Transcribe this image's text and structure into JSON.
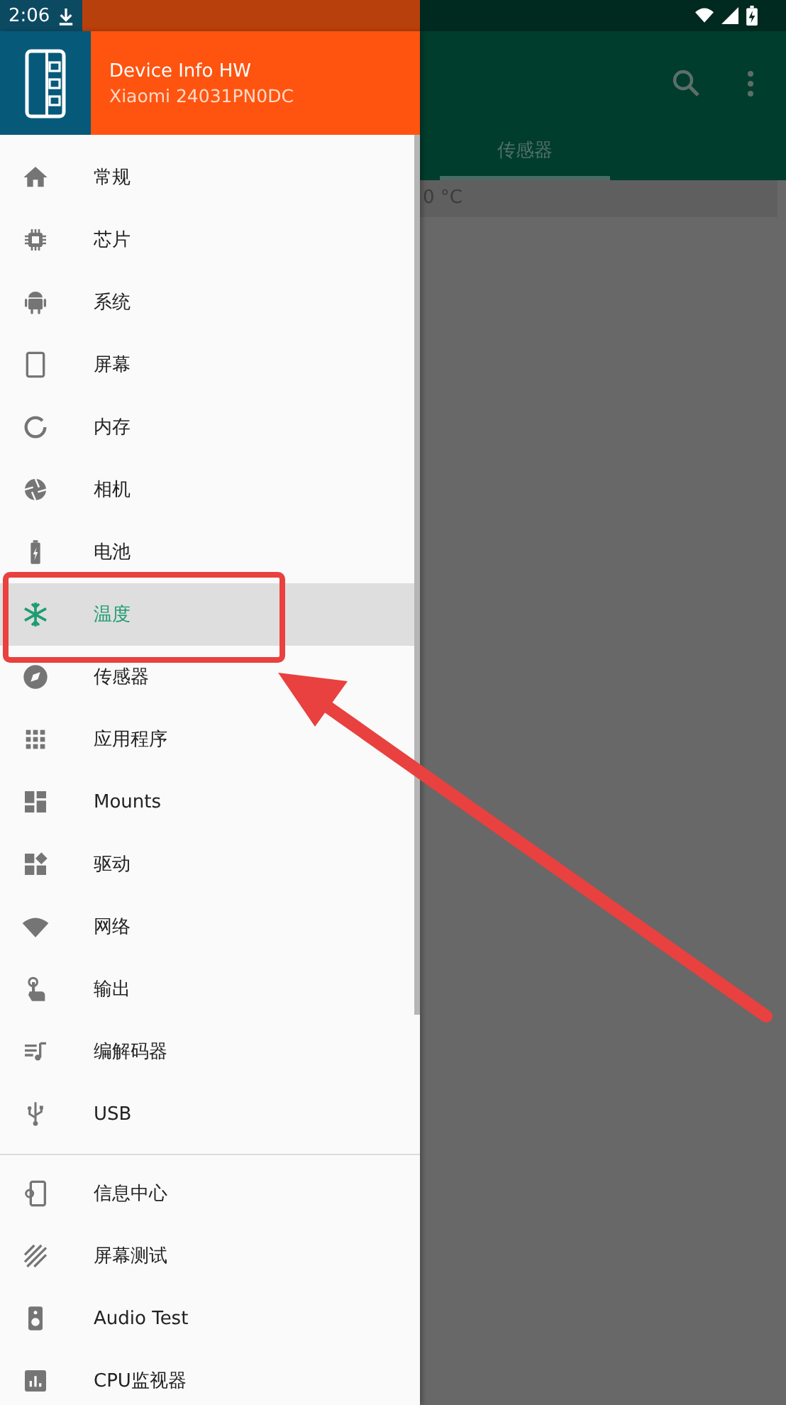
{
  "status_bar": {
    "time": "2:06"
  },
  "app": {
    "tabs": [
      {
        "label": "传感器",
        "selected": true
      }
    ],
    "rows": [
      {
        "value": "0 °C"
      }
    ]
  },
  "drawer": {
    "title": "Device Info HW",
    "subtitle": "Xiaomi 24031PN0DC",
    "sections": [
      {
        "items": [
          {
            "label": "常规",
            "selected": false
          },
          {
            "label": "芯片",
            "selected": false
          },
          {
            "label": "系统",
            "selected": false
          },
          {
            "label": "屏幕",
            "selected": false
          },
          {
            "label": "内存",
            "selected": false
          },
          {
            "label": "相机",
            "selected": false
          },
          {
            "label": "电池",
            "selected": false
          },
          {
            "label": "温度",
            "selected": true
          },
          {
            "label": "传感器",
            "selected": false
          },
          {
            "label": "应用程序",
            "selected": false
          },
          {
            "label": "Mounts",
            "selected": false
          },
          {
            "label": "驱动",
            "selected": false
          },
          {
            "label": "网络",
            "selected": false
          },
          {
            "label": "输出",
            "selected": false
          },
          {
            "label": "编解码器",
            "selected": false
          },
          {
            "label": "USB",
            "selected": false
          }
        ]
      },
      {
        "items": [
          {
            "label": "信息中心",
            "selected": false
          },
          {
            "label": "屏幕测试",
            "selected": false
          },
          {
            "label": "Audio Test",
            "selected": false
          },
          {
            "label": "CPU监视器",
            "selected": false
          }
        ]
      }
    ]
  }
}
